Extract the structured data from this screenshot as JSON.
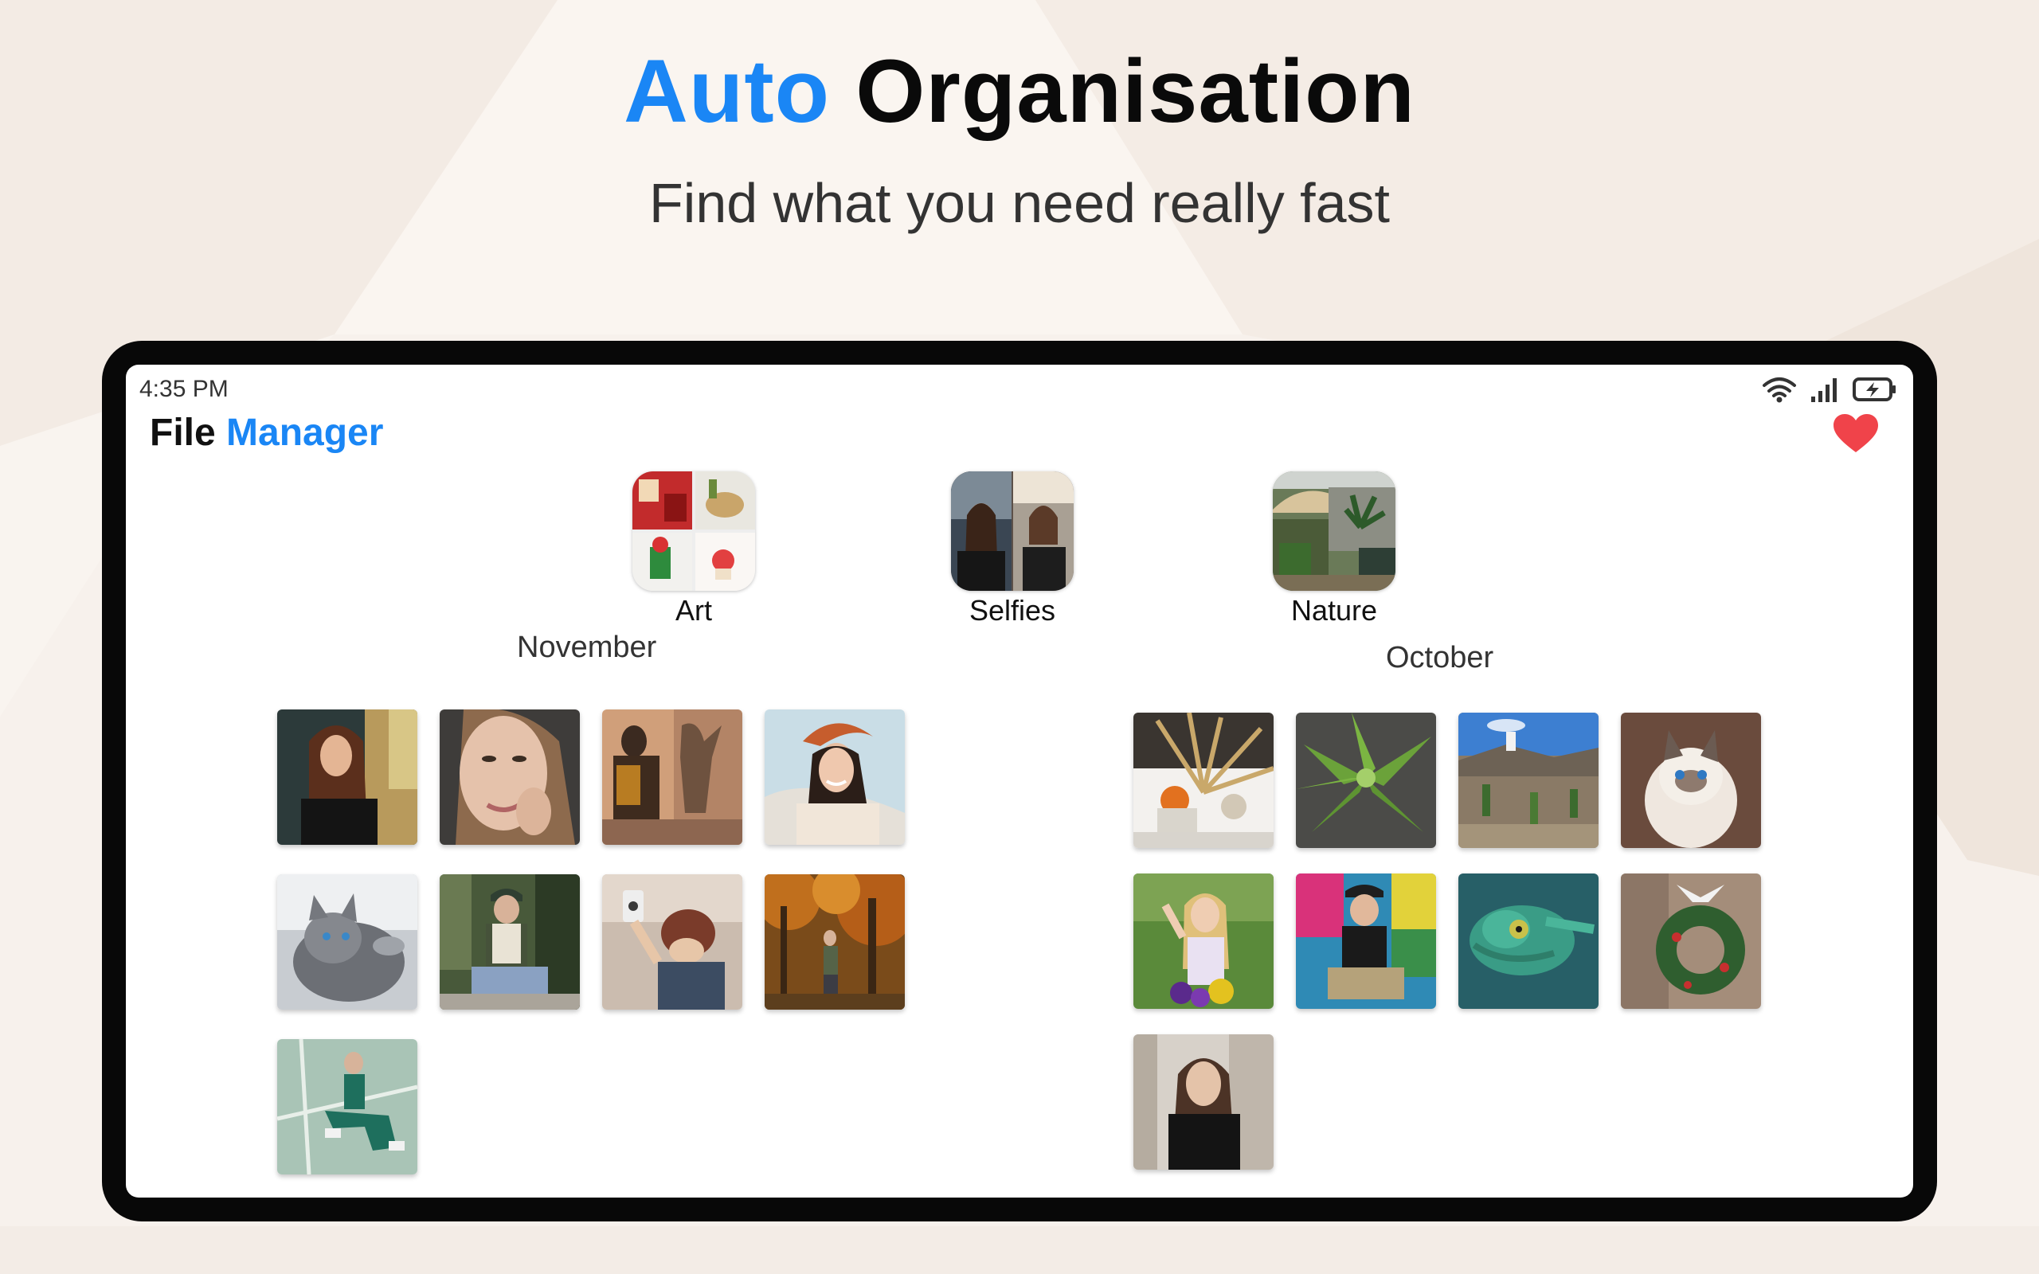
{
  "hero": {
    "title_accent": "Auto",
    "title_rest": "Organisation",
    "subtitle": "Find what you need really fast"
  },
  "status_bar": {
    "time": "4:35 PM",
    "icons": [
      "wifi-icon",
      "signal-icon",
      "battery-charging-icon"
    ]
  },
  "app_bar": {
    "title_plain": "File",
    "title_accent": "Manager",
    "action_icon": "heart-icon"
  },
  "albums": [
    {
      "label": "Art",
      "icon": "art-collage-thumbnail"
    },
    {
      "label": "Selfies",
      "icon": "selfies-collage-thumbnail"
    },
    {
      "label": "Nature",
      "icon": "nature-thumbnail"
    }
  ],
  "sections": [
    {
      "month": "November",
      "photos": [
        "woman-portrait",
        "woman-face-closeup",
        "shadow-wall",
        "smiling-woman-beret",
        "kitten-grey",
        "woman-cap-sitting",
        "selfie-beanie",
        "autumn-forest",
        "woman-green-court"
      ]
    },
    {
      "month": "October",
      "photos": [
        "dried-plants-oranges",
        "agave-plant",
        "cactus-garden",
        "fluffy-kitten",
        "blonde-selfie-flowers",
        "woman-graffiti",
        "chameleon",
        "christmas-wreath",
        "woman-black-coat"
      ]
    }
  ],
  "colors": {
    "accent": "#1a86f5",
    "heart": "#f0434a",
    "device_frame": "#080808",
    "background": "#f7f1ec"
  }
}
